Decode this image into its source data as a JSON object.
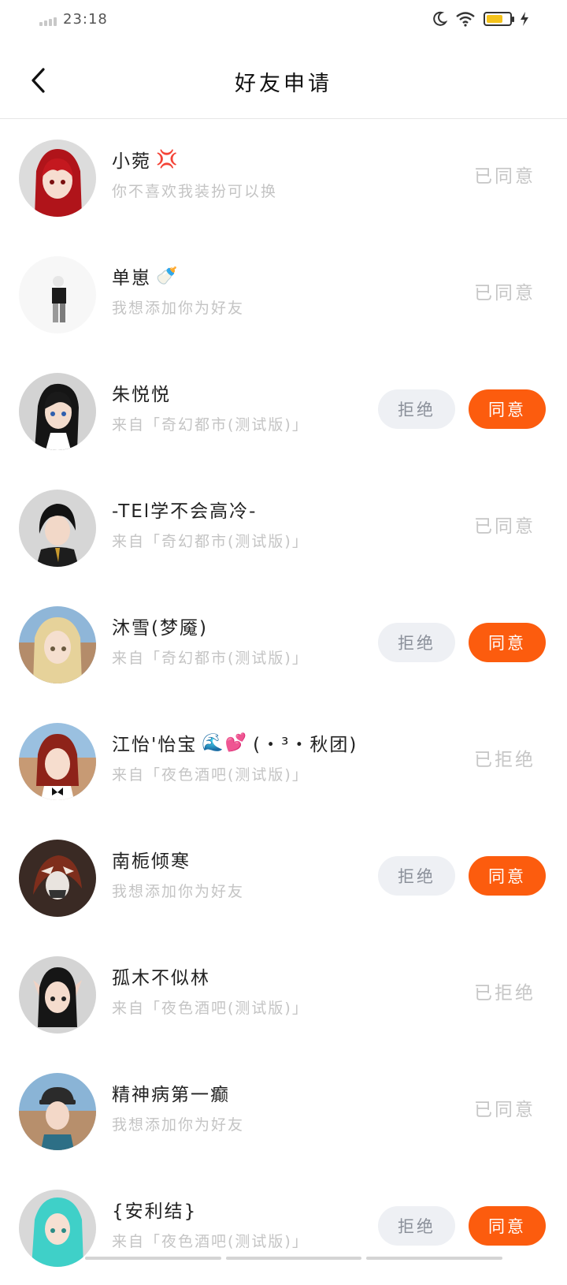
{
  "status_bar": {
    "time": "23:18",
    "icons": [
      "signal-icon",
      "moon-icon",
      "wifi-icon",
      "battery-icon",
      "charging-icon"
    ],
    "battery_color": "#f4c21a"
  },
  "header": {
    "back_icon": "chevron-left-icon",
    "title": "好友申请"
  },
  "actions": {
    "reject_label": "拒绝",
    "accept_label": "同意"
  },
  "requests": [
    {
      "name": "小菀",
      "emoji": "💢",
      "message": "你不喜欢我装扮可以换",
      "status": "已同意",
      "pending": false
    },
    {
      "name": "单崽",
      "emoji": "🍼",
      "message": "我想添加你为好友",
      "status": "已同意",
      "pending": false
    },
    {
      "name": "朱悦悦",
      "emoji": "",
      "message": "来自「奇幻都市(测试版)」",
      "status": "",
      "pending": true
    },
    {
      "name": "-TEl学不会高冷-",
      "emoji": "",
      "message": "来自「奇幻都市(测试版)」",
      "status": "已同意",
      "pending": false
    },
    {
      "name": "沐雪(梦魇)",
      "emoji": "",
      "message": "来自「奇幻都市(测试版)」",
      "status": "",
      "pending": true
    },
    {
      "name": "江怡'怡宝",
      "emoji": "🌊💕",
      "name_suffix": "(・³・秋团)",
      "message": "来自「夜色酒吧(测试版)」",
      "status": "已拒绝",
      "pending": false
    },
    {
      "name": "南栀倾寒",
      "emoji": "",
      "message": "我想添加你为好友",
      "status": "",
      "pending": true
    },
    {
      "name": "孤木不似林",
      "emoji": "",
      "message": "来自「夜色酒吧(测试版)」",
      "status": "已拒绝",
      "pending": false
    },
    {
      "name": "精神病第一癫",
      "emoji": "",
      "message": "我想添加你为好友",
      "status": "已同意",
      "pending": false
    },
    {
      "name": "{安利结}",
      "emoji": "",
      "message": "来自「夜色酒吧(测试版)」",
      "status": "",
      "pending": true
    }
  ]
}
